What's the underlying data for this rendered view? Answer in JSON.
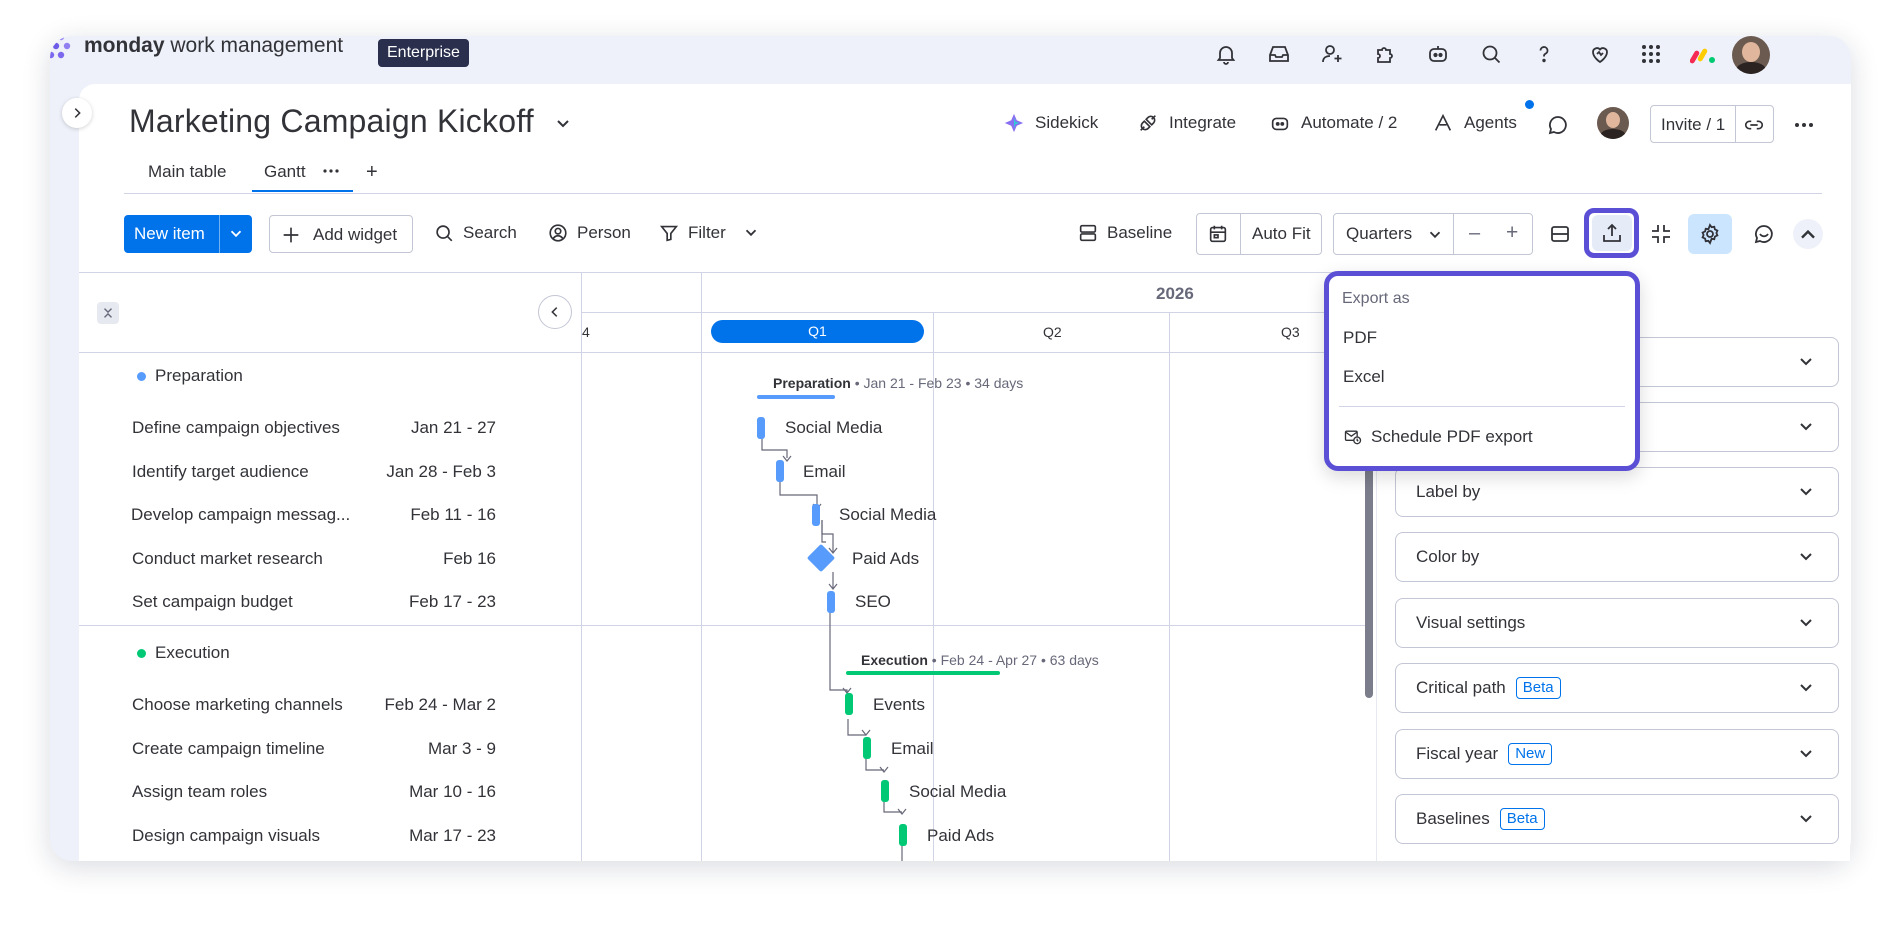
{
  "app": {
    "brand_bold": "monday",
    "brand_rest": " work management",
    "plan_badge": "Enterprise"
  },
  "topbar": {
    "icons": [
      "bell-icon",
      "inbox-icon",
      "invite-members-icon",
      "apps-icon",
      "ai-assistant-icon",
      "search-icon",
      "help-icon",
      "heart-icon",
      "apps-grid-icon",
      "monday-logo-icon",
      "user-avatar"
    ]
  },
  "board": {
    "title": "Marketing Campaign Kickoff",
    "actions": {
      "sidekick": "Sidekick",
      "integrate": "Integrate",
      "automate": "Automate / 2",
      "agents": "Agents",
      "invite": "Invite / 1"
    },
    "tabs": [
      {
        "label": "Main table"
      },
      {
        "label": "Gantt",
        "active": true
      }
    ],
    "add_tab": "+"
  },
  "toolbar": {
    "new_item": "New item",
    "add_widget": "Add widget",
    "search": "Search",
    "person": "Person",
    "filter": "Filter",
    "baseline": "Baseline",
    "auto_fit": "Auto Fit",
    "scale": "Quarters",
    "zoom_out": "–",
    "zoom_in": "+"
  },
  "timeline": {
    "year": "2026",
    "prev_quarter": "4",
    "quarters": [
      "Q1",
      "Q2",
      "Q3"
    ]
  },
  "groups": [
    {
      "name": "Preparation",
      "color": "#579bfc",
      "summary_name": "Preparation",
      "summary_meta": " • Jan 21 - Feb 23 • 34 days",
      "tasks": [
        {
          "name": "Define campaign objectives",
          "dates": "Jan 21 - 27",
          "bar_label": "Social Media"
        },
        {
          "name": "Identify target audience",
          "dates": "Jan 28 - Feb 3",
          "bar_label": "Email"
        },
        {
          "name": "Develop campaign messag...",
          "dates": "Feb 11 - 16",
          "bar_label": "Social Media"
        },
        {
          "name": "Conduct market research",
          "dates": "Feb 16",
          "bar_label": "Paid Ads"
        },
        {
          "name": "Set campaign budget",
          "dates": "Feb 17 - 23",
          "bar_label": "SEO"
        }
      ]
    },
    {
      "name": "Execution",
      "color": "#00c875",
      "summary_name": "Execution",
      "summary_meta": " • Feb 24 - Apr 27 • 63 days",
      "tasks": [
        {
          "name": "Choose marketing channels",
          "dates": "Feb 24 - Mar 2",
          "bar_label": "Events"
        },
        {
          "name": "Create campaign timeline",
          "dates": "Mar 3 - 9",
          "bar_label": "Email"
        },
        {
          "name": "Assign team roles",
          "dates": "Mar 10 - 16",
          "bar_label": "Social Media"
        },
        {
          "name": "Design campaign visuals",
          "dates": "Mar 17 - 23",
          "bar_label": "Paid Ads"
        }
      ]
    }
  ],
  "export_menu": {
    "heading": "Export as",
    "items": [
      "PDF",
      "Excel"
    ],
    "schedule": "Schedule PDF export"
  },
  "settings": {
    "items": [
      {
        "label": "Label by"
      },
      {
        "label": "Color by"
      },
      {
        "label": "Visual settings"
      },
      {
        "label": "Critical path",
        "tag": "Beta"
      },
      {
        "label": "Fiscal year",
        "tag": "New"
      },
      {
        "label": "Baselines",
        "tag": "Beta"
      }
    ]
  },
  "colors": {
    "primary": "#0073ea",
    "highlight": "#5b4fd6",
    "preparation": "#579bfc",
    "execution": "#00c875",
    "enterprise_badge": "#292f4c"
  }
}
